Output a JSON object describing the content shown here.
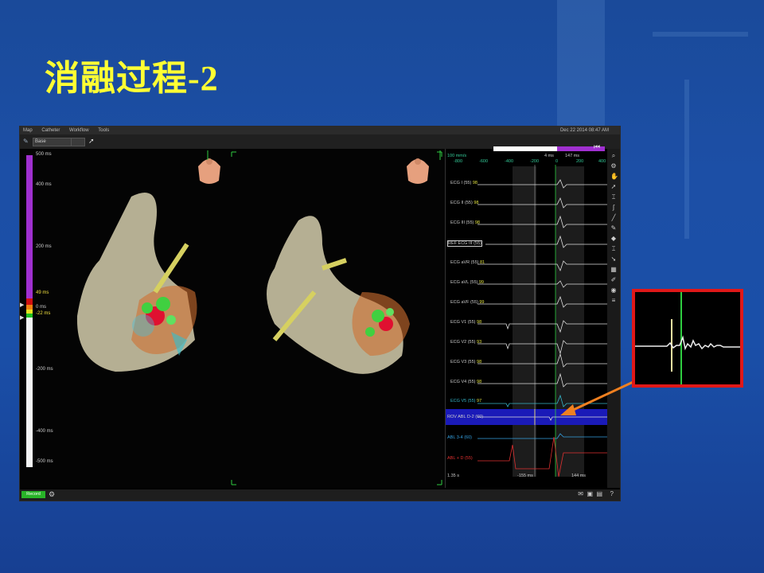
{
  "slide": {
    "title": "消融过程-2"
  },
  "colors": {
    "accent_title": "#ffff33",
    "zoom_border": "#e01818",
    "arrow": "#f08020"
  },
  "app": {
    "menu": [
      "Map",
      "Catheter",
      "Workflow",
      "Tools"
    ],
    "clock": "Dec 22 2014 08:47 AM",
    "toolbar": {
      "view_select": "Base",
      "icon_cursor": "cursor-icon"
    },
    "scale": {
      "ticks": [
        "500 ms",
        "400 ms",
        "200 ms",
        "49 ms",
        "0 ms",
        "-22 ms",
        "-200 ms",
        "-400 ms",
        "-500 ms"
      ]
    },
    "ecg": {
      "speed": "100 mm/s",
      "axis": [
        "-800",
        "-600",
        "-400",
        "-200",
        "0",
        "200",
        "400"
      ],
      "marker_left": "4 ms",
      "marker_right": "147 ms",
      "channels": [
        {
          "name": "ECG I (55)",
          "value": "98"
        },
        {
          "name": "ECG II (55)",
          "value": "98"
        },
        {
          "name": "ECG III (55)",
          "value": "98"
        },
        {
          "name": "REF ECG III (55)",
          "value": ""
        },
        {
          "name": "ECG aVR (55)",
          "value": "81"
        },
        {
          "name": "ECG aVL (55)",
          "value": "99"
        },
        {
          "name": "ECG aVF (55)",
          "value": "99"
        },
        {
          "name": "ECG V1 (55)",
          "value": "98"
        },
        {
          "name": "ECG V2 (55)",
          "value": "93"
        },
        {
          "name": "ECG V3 (55)",
          "value": "98"
        },
        {
          "name": "ECG V4 (55)",
          "value": "98"
        },
        {
          "name": "ECG V5 (55)",
          "value": "97"
        },
        {
          "name": "ROV ABL D-2 (60)",
          "value": ""
        },
        {
          "name": "ABL 3-4 (60)",
          "value": ""
        },
        {
          "name": "ABL + D (55)",
          "value": ""
        }
      ],
      "footer": {
        "left": "1.35 s",
        "mid": "-155 ms",
        "right": "144 ms"
      }
    },
    "status": {
      "record_label": "Record"
    }
  }
}
